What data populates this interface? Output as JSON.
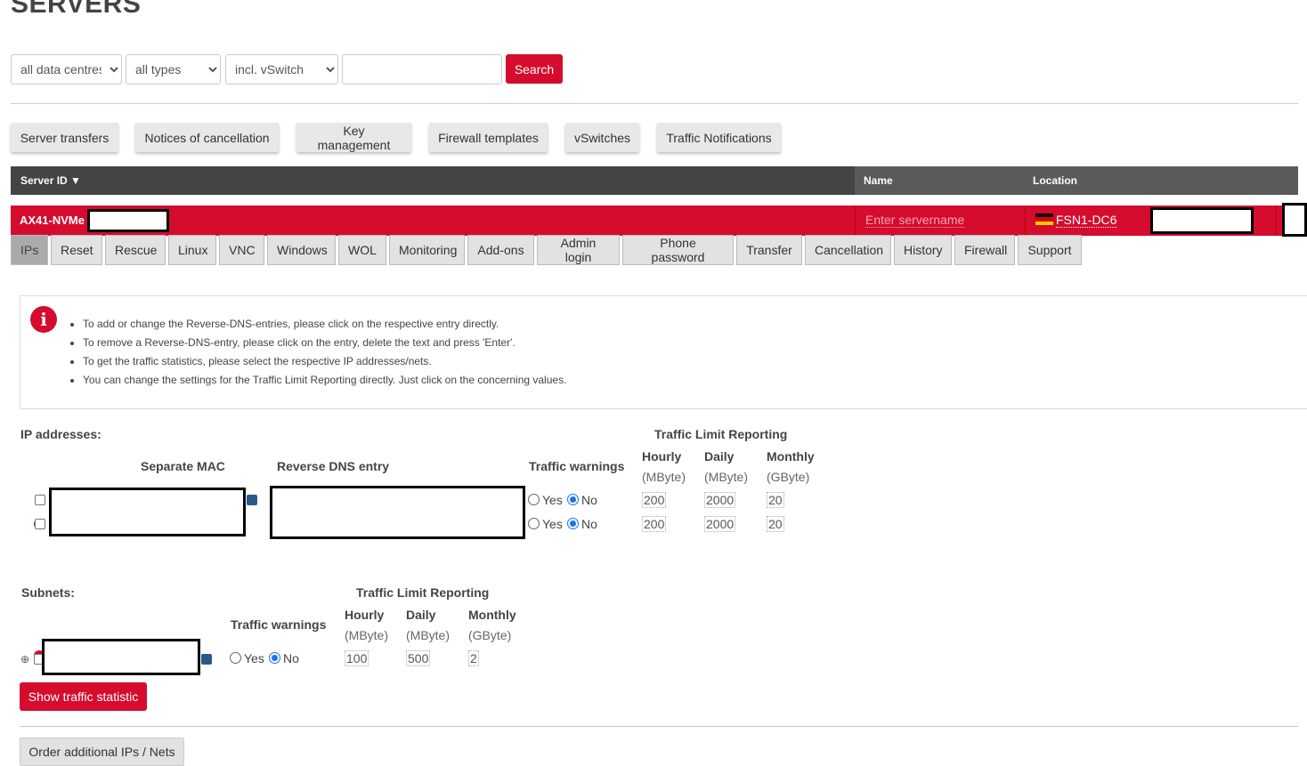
{
  "page": {
    "title": "SERVERS"
  },
  "filters": {
    "datacentre": "all data centres",
    "type": "all types",
    "vswitch": "incl. vSwitch",
    "search_label": "Search"
  },
  "toolbar": [
    "Server transfers",
    "Notices of cancellation",
    "Key management",
    "Firewall templates",
    "vSwitches",
    "Traffic Notifications"
  ],
  "table": {
    "col_server_id": "Server ID",
    "col_name": "Name",
    "col_location": "Location"
  },
  "server": {
    "id_prefix": "AX41-NVMe",
    "name_placeholder": "Enter servername",
    "location": "FSN1-DC6"
  },
  "tabs": [
    "IPs",
    "Reset",
    "Rescue",
    "Linux",
    "VNC",
    "Windows",
    "WOL",
    "Monitoring",
    "Add-ons",
    "Admin login",
    "Phone password",
    "Transfer",
    "Cancellation",
    "History",
    "Firewall",
    "Support"
  ],
  "info": [
    "To add or change the Reverse-DNS-entries, please click on the respective entry directly.",
    "To remove a Reverse-DNS-entry, please click on the entry, delete the text and press 'Enter'.",
    "To get the traffic statistics, please select the respective IP addresses/nets.",
    "You can change the settings for the Traffic Limit Reporting directly. Just click on the concerning values."
  ],
  "ips": {
    "section_label": "IP addresses:",
    "col_mac": "Separate MAC",
    "col_rdns": "Reverse DNS entry",
    "col_warnings": "Traffic warnings",
    "tlr_label": "Traffic Limit Reporting",
    "hourly": "Hourly",
    "daily": "Daily",
    "monthly": "Monthly",
    "unit_mb": "(MByte)",
    "unit_gb": "(GByte)",
    "yes": "Yes",
    "no": "No",
    "rows": [
      {
        "hourly": "200",
        "daily": "2000",
        "monthly": "20"
      },
      {
        "hourly": "200",
        "daily": "2000",
        "monthly": "20"
      }
    ]
  },
  "subnets": {
    "section_label": "Subnets:",
    "col_warnings": "Traffic warnings",
    "tlr_label": "Traffic Limit Reporting",
    "hourly": "Hourly",
    "daily": "Daily",
    "monthly": "Monthly",
    "unit_mb": "(MByte)",
    "unit_gb": "(GByte)",
    "yes": "Yes",
    "no": "No",
    "row": {
      "hourly": "100",
      "daily": "500",
      "monthly": "2"
    }
  },
  "actions": {
    "show_traffic": "Show traffic statistic",
    "order_ips": "Order additional IPs / Nets"
  }
}
